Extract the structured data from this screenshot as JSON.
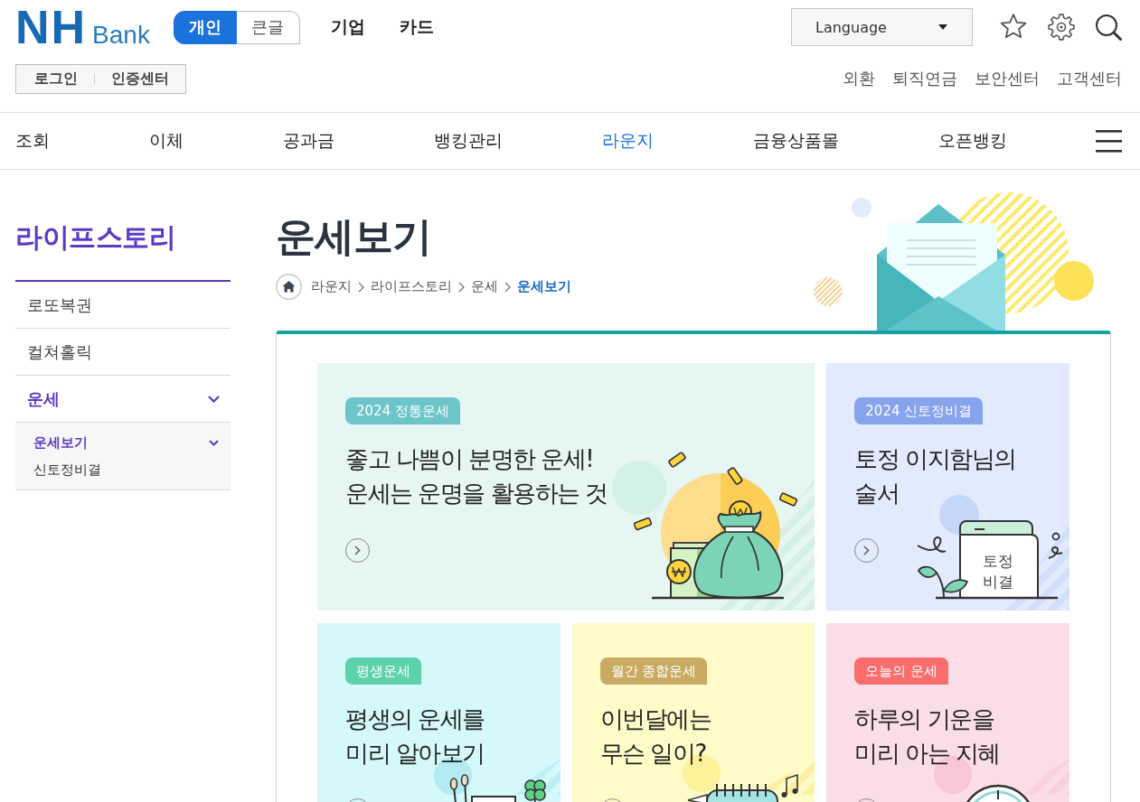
{
  "header": {
    "logo": {
      "mark": "NH",
      "wordmark": "Bank"
    },
    "mode_toggle": [
      {
        "label": "개인",
        "selected": true
      },
      {
        "label": "큰글",
        "selected": false
      }
    ],
    "top_links": [
      "기업",
      "카드"
    ],
    "language_select": {
      "value": "Language"
    },
    "account_links": [
      "로그인",
      "인증센터"
    ],
    "utility_links": [
      "외환",
      "퇴직연금",
      "보안센터",
      "고객센터"
    ]
  },
  "main_nav": [
    {
      "label": "조회",
      "selected": false
    },
    {
      "label": "이체",
      "selected": false
    },
    {
      "label": "공과금",
      "selected": false
    },
    {
      "label": "뱅킹관리",
      "selected": false
    },
    {
      "label": "라운지",
      "selected": true
    },
    {
      "label": "금융상품몰",
      "selected": false
    },
    {
      "label": "오픈뱅킹",
      "selected": false
    }
  ],
  "sidebar": {
    "title": "라이프스토리",
    "items": [
      {
        "label": "로또복권",
        "selected": false,
        "expanded": false
      },
      {
        "label": "컬쳐홀릭",
        "selected": false,
        "expanded": false
      },
      {
        "label": "운세",
        "selected": true,
        "expanded": true,
        "children": [
          {
            "label": "운세보기",
            "selected": true,
            "expanded": true
          },
          {
            "label": "신토정비결",
            "selected": false,
            "expanded": false
          }
        ]
      }
    ]
  },
  "page": {
    "title": "운세보기",
    "breadcrumb": [
      {
        "label": "라운지",
        "current": false
      },
      {
        "label": "라이프스토리",
        "current": false
      },
      {
        "label": "운세",
        "current": false
      },
      {
        "label": "운세보기",
        "current": true
      }
    ]
  },
  "cards": [
    {
      "tag": "2024 정통운세",
      "color": "#6cc5c9",
      "headline": "좋고 나쁨이 분명한 운세!\n운세는 운명을 활용하는 것"
    },
    {
      "tag": "2024 신토정비결",
      "color": "#87a3ec",
      "headline": "토정 이지함님의\n술서",
      "illustration_text": "토정\n비결"
    },
    {
      "tag": "평생운세",
      "color": "#5dd2aa",
      "headline": "평생의 운세를\n미리 알아보기"
    },
    {
      "tag": "월간 종합운세",
      "color": "#c9aa62",
      "headline": "이번달에는\n무슨 일이?"
    },
    {
      "tag": "오늘의 운세",
      "color": "#fb6c6c",
      "headline": "하루의 기운을\n미리 아는 지혜"
    }
  ]
}
